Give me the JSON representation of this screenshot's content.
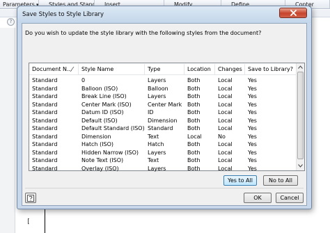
{
  "ribbon": {
    "tabs": [
      {
        "label": "Parameters",
        "dropdown": true
      },
      {
        "label": "Styles and Standards",
        "dropdown": false
      },
      {
        "label": "Insert",
        "dropdown": false
      },
      {
        "label": "Modify",
        "dropdown": false
      },
      {
        "label": "Define",
        "dropdown": false
      },
      {
        "label": "Conter",
        "dropdown": false
      }
    ]
  },
  "canvas": {
    "help_glyph": "?",
    "bracket_glyph": "["
  },
  "dialog": {
    "title": "Save Styles to Style Library",
    "prompt": "Do you wish to update the style library with the following styles from the document?",
    "columns": [
      "Document N...",
      "Style Name",
      "Type",
      "Location",
      "Changes",
      "Save to Library?"
    ],
    "rows": [
      [
        "Standard",
        "0",
        "Layers",
        "Both",
        "Local",
        "Yes"
      ],
      [
        "Standard",
        "Balloon (ISO)",
        "Balloon",
        "Both",
        "Local",
        "Yes"
      ],
      [
        "Standard",
        "Break Line (ISO)",
        "Layers",
        "Both",
        "Local",
        "Yes"
      ],
      [
        "Standard",
        "Center Mark (ISO)",
        "Center Mark",
        "Both",
        "Local",
        "Yes"
      ],
      [
        "Standard",
        "Datum ID (ISO)",
        "ID",
        "Both",
        "Local",
        "Yes"
      ],
      [
        "Standard",
        "Default (ISO)",
        "Dimension",
        "Both",
        "Local",
        "Yes"
      ],
      [
        "Standard",
        "Default Standard (ISO)",
        "Standard",
        "Both",
        "Local",
        "Yes"
      ],
      [
        "Standard",
        "Dimension",
        "Text",
        "Local",
        "No",
        "Yes"
      ],
      [
        "Standard",
        "Hatch (ISO)",
        "Hatch",
        "Both",
        "Local",
        "Yes"
      ],
      [
        "Standard",
        "Hidden Narrow (ISO)",
        "Layers",
        "Both",
        "Local",
        "Yes"
      ],
      [
        "Standard",
        "Note Text (ISO)",
        "Text",
        "Both",
        "Local",
        "Yes"
      ],
      [
        "Standard",
        "Overlay (ISO)",
        "Layers",
        "Both",
        "Local",
        "Yes"
      ]
    ],
    "buttons": {
      "yes_to_all": "Yes to All",
      "no_to_all": "No to All",
      "ok": "OK",
      "cancel": "Cancel"
    },
    "info_icon": "info-icon",
    "close_icon": "close-icon"
  },
  "colors": {
    "dialog_frame": "#c8d8ea",
    "close_button": "#c7432b",
    "default_button": "#3c7fb1"
  }
}
